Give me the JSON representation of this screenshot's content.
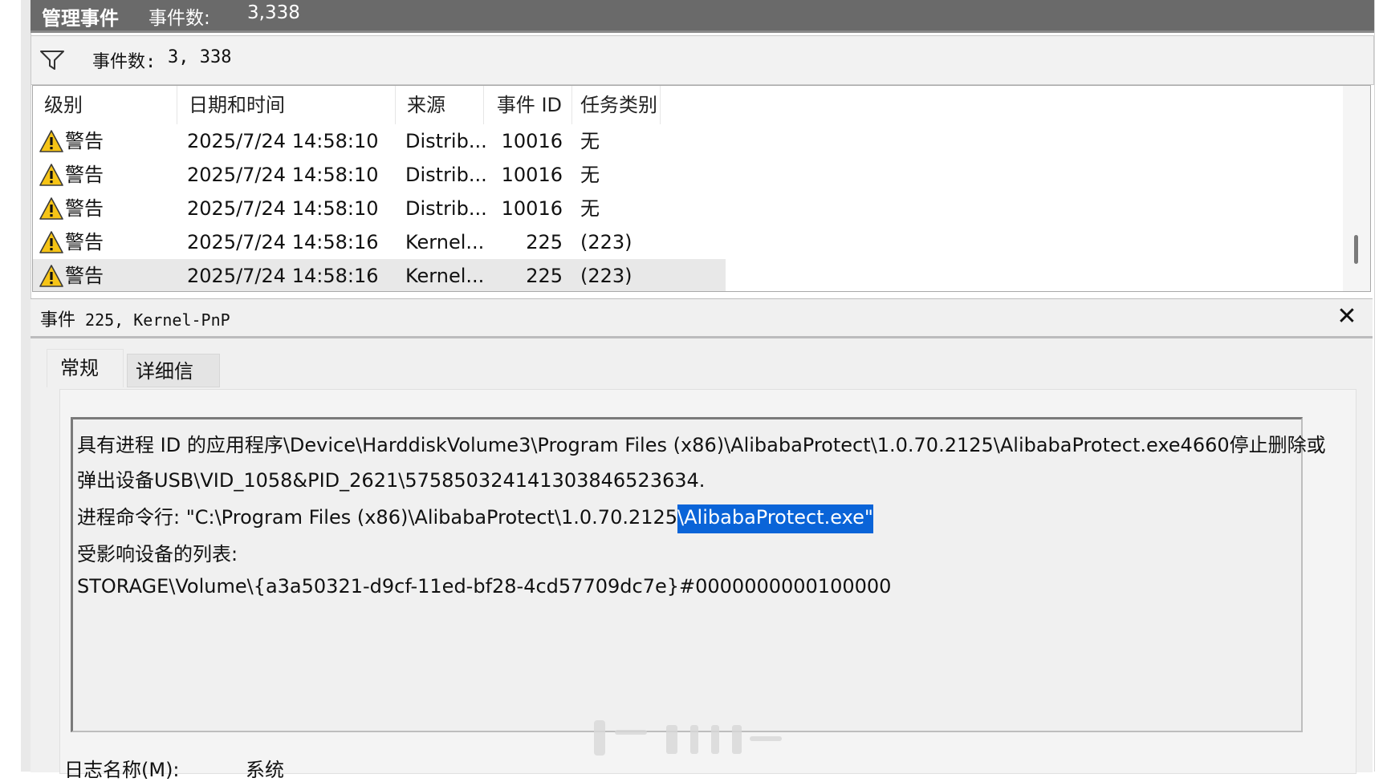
{
  "titlebar": {
    "title": "管理事件",
    "count_label": "事件数:",
    "count": "3,338"
  },
  "filter": {
    "icon": "filter-icon",
    "label": "事件数:",
    "count": "3, 338"
  },
  "grid": {
    "columns": [
      "级别",
      "日期和时间",
      "来源",
      "事件 ID",
      "任务类别"
    ],
    "sort_indicator": "^",
    "rows": [
      {
        "level": "警告",
        "datetime": "2025/7/24 14:58:10",
        "source": "Distrib...",
        "event_id": "10016",
        "task": "无"
      },
      {
        "level": "警告",
        "datetime": "2025/7/24 14:58:10",
        "source": "Distrib...",
        "event_id": "10016",
        "task": "无"
      },
      {
        "level": "警告",
        "datetime": "2025/7/24 14:58:10",
        "source": "Distrib...",
        "event_id": "10016",
        "task": "无"
      },
      {
        "level": "警告",
        "datetime": "2025/7/24 14:58:16",
        "source": "Kernel...",
        "event_id": "225",
        "task": "(223)"
      },
      {
        "level": "警告",
        "datetime": "2025/7/24 14:58:16",
        "source": "Kernel...",
        "event_id": "225",
        "task": "(223)"
      }
    ],
    "selected_row_index": 4,
    "level_icon": "warning-icon"
  },
  "detail": {
    "title_prefix": "事件",
    "title_rest": " 225, Kernel-PnP",
    "close_label": "✕",
    "tabs": [
      "常规",
      "详细信息"
    ],
    "active_tab": "常规",
    "description": {
      "line1": "具有进程 ID 的应用程序\\Device\\HarddiskVolume3\\Program Files (x86)\\AlibabaProtect\\1.0.70.2125\\AlibabaProtect.exe4660停止删除或",
      "line2": "弹出设备USB\\VID_1058&PID_2621\\575850324141303846523634.",
      "line3_before": "进程命令行:  \"C:\\Program Files (x86)\\AlibabaProtect\\1.0.70.2125",
      "line3_selected": "\\AlibabaProtect.exe\"",
      "line4": "受影响设备的列表:",
      "line5": "STORAGE\\Volume\\{a3a50321-d9cf-11ed-bf28-4cd57709dc7e}#0000000000100000"
    },
    "log_name_label": "日志名称(M):",
    "log_name_value": "系统"
  },
  "colors": {
    "titlebar_bg": "#6a6a6a",
    "selection": "#0a64d8",
    "warning_yellow": "#f6c416"
  }
}
